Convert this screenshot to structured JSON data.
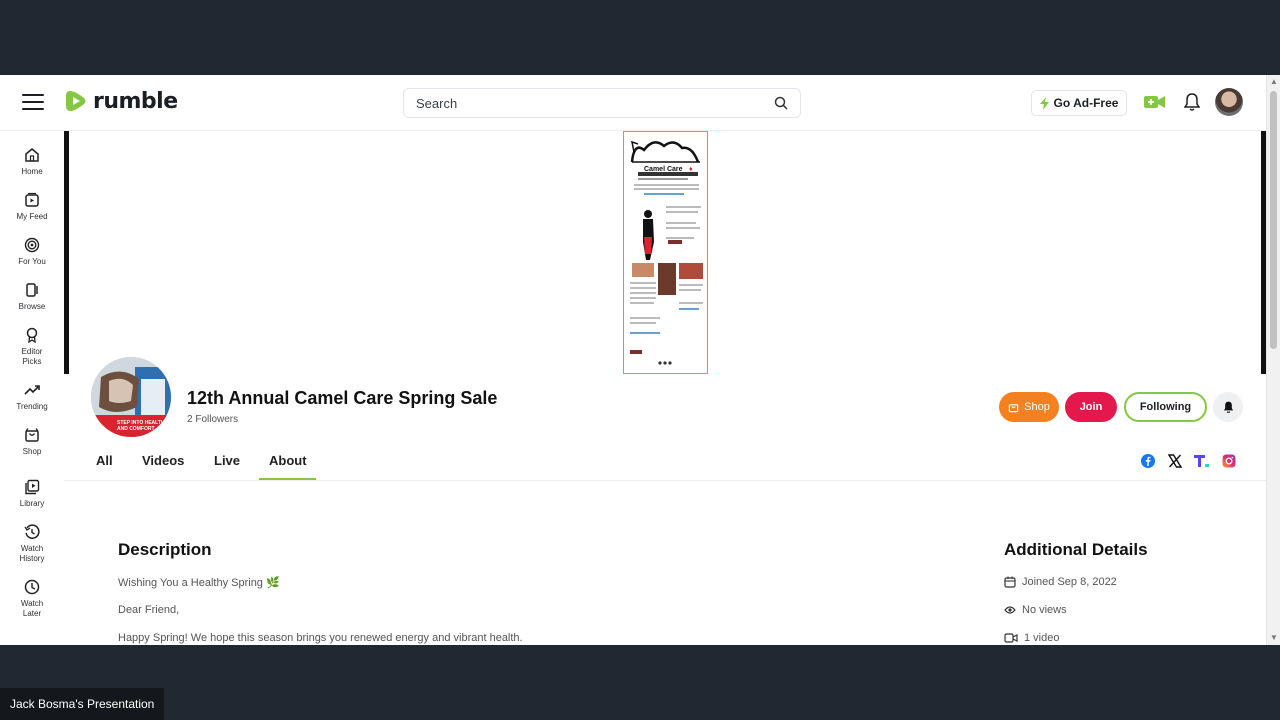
{
  "header": {
    "logo_text": "rumble",
    "search_placeholder": "Search",
    "go_adfree_label": "Go Ad-Free"
  },
  "sidebar": {
    "items": [
      {
        "label": "Home",
        "icon": "home-icon"
      },
      {
        "label": "My Feed",
        "icon": "feed-icon"
      },
      {
        "label": "For You",
        "icon": "target-icon"
      },
      {
        "label": "Browse",
        "icon": "browse-icon"
      },
      {
        "label": "Editor Picks",
        "icon": "award-icon"
      },
      {
        "label": "Trending",
        "icon": "trending-icon"
      },
      {
        "label": "Shop",
        "icon": "shop-bag-icon"
      },
      {
        "label": "Library",
        "icon": "library-icon"
      },
      {
        "label": "Watch History",
        "icon": "history-icon"
      },
      {
        "label": "Watch Later",
        "icon": "clock-icon"
      }
    ]
  },
  "banner": {
    "flyer_brand": "Camel Care"
  },
  "channel": {
    "title": "12th Annual Camel Care Spring Sale",
    "followers": "2 Followers",
    "avatar_caption": "STEP INTO HEALTH AND COMFORT",
    "shop_label": "Shop",
    "join_label": "Join",
    "following_label": "Following"
  },
  "tabs": [
    {
      "label": "All"
    },
    {
      "label": "Videos"
    },
    {
      "label": "Live"
    },
    {
      "label": "About",
      "active": true
    }
  ],
  "about": {
    "description_heading": "Description",
    "lines": [
      "Wishing You a Healthy Spring 🌿",
      "Dear Friend,",
      "Happy Spring! We hope this season brings you renewed energy and vibrant health."
    ],
    "details_heading": "Additional Details",
    "joined": "Joined Sep 8, 2022",
    "views": "No views",
    "videos": "1 video"
  },
  "presenter_label": "Jack Bosma's Presentation",
  "colors": {
    "brand_green": "#85c742",
    "shop_orange": "#f4811f",
    "join_red": "#e5184d",
    "background_dark": "#222831"
  }
}
